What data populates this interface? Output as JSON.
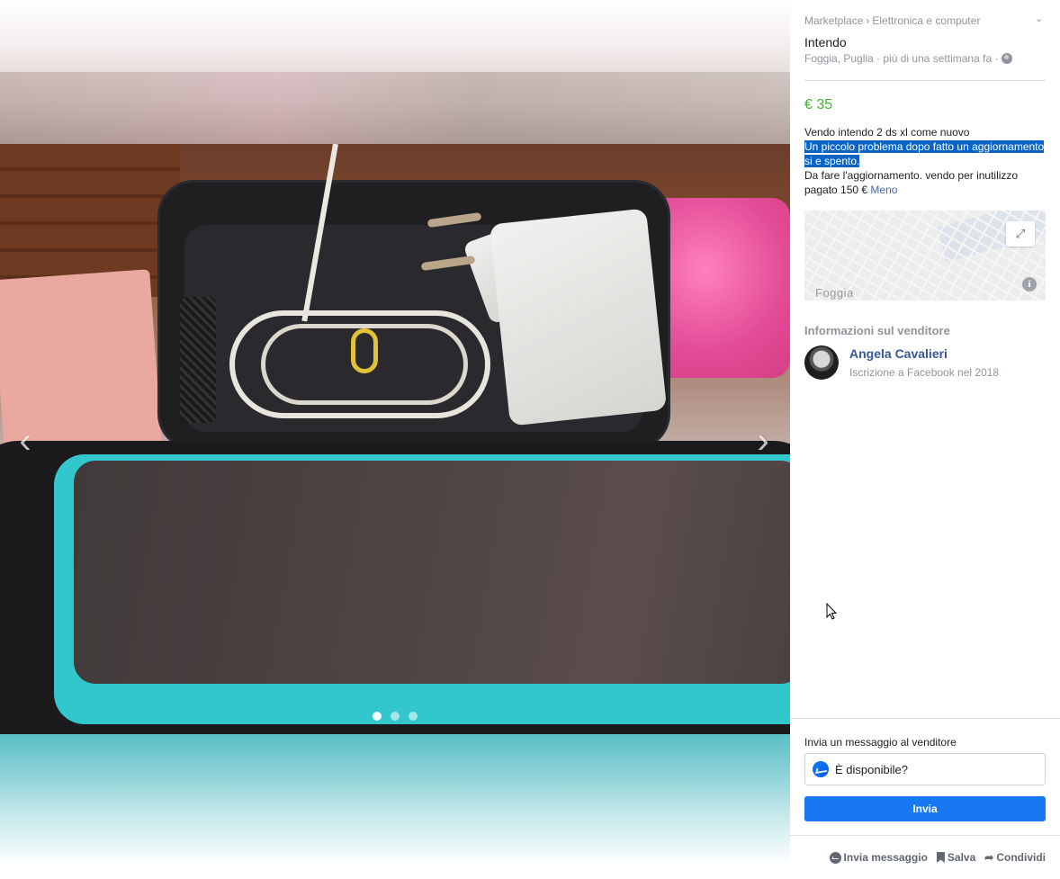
{
  "viewer": {
    "prev_glyph": "‹",
    "next_glyph": "›",
    "photo_count": 3,
    "active_photo": 1
  },
  "sidebar": {
    "breadcrumb": {
      "root": "Marketplace",
      "separator": "›",
      "category": "Elettronica e computer"
    },
    "collapse_glyph": "⌄",
    "title": "Intendo",
    "meta": "Foggia, Puglia · più di una settimana fa ·",
    "price": "€ 35",
    "description": {
      "line1": "Vendo intendo 2 ds xl come nuovo",
      "highlighted": "Un piccolo problema dopo fatto un aggiornamento si e spento. ",
      "line3": "Da fare l'aggiornamento. vendo per inutilizzo pagato 150 € ",
      "less_link": "Meno"
    },
    "map": {
      "city_label": "Foggia",
      "expand_glyph": "⤢",
      "info_glyph": "i"
    },
    "seller": {
      "heading": "Informazioni sul venditore",
      "name": "Angela Cavalieri",
      "joined": "Iscrizione a Facebook nel 2018"
    },
    "message": {
      "label": "Invia un messaggio al venditore",
      "input_value": "È disponibile?",
      "send_label": "Invia"
    },
    "actions": {
      "message": "Invia messaggio",
      "save": "Salva",
      "share": "Condividi",
      "share_glyph": "➦"
    }
  },
  "colors": {
    "price": "#42b72a",
    "link": "#4267b2",
    "seller_name": "#365899",
    "send_button": "#1877f2",
    "highlight": "#0a64c8"
  }
}
